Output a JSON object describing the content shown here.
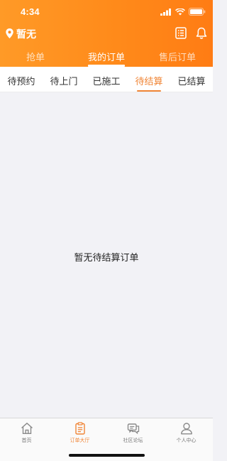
{
  "status_bar": {
    "time": "4:34"
  },
  "header": {
    "location": "暂无",
    "location_icon": "location-pin-icon",
    "list_icon": "list-document-icon",
    "bell_icon": "bell-icon",
    "background_color": "#ff8a1a"
  },
  "top_tabs": [
    {
      "label": "抢单",
      "active": false
    },
    {
      "label": "我的订单",
      "active": true
    },
    {
      "label": "售后订单",
      "active": false
    }
  ],
  "sub_tabs": [
    {
      "label": "待预约",
      "active": false
    },
    {
      "label": "待上门",
      "active": false
    },
    {
      "label": "已施工",
      "active": false
    },
    {
      "label": "待结算",
      "active": true
    },
    {
      "label": "已结算",
      "active": false
    }
  ],
  "main": {
    "empty_message": "暂无待结算订单"
  },
  "tabbar": [
    {
      "label": "首页",
      "icon": "home-icon",
      "active": false
    },
    {
      "label": "订单大厅",
      "icon": "clipboard-icon",
      "active": true
    },
    {
      "label": "社区论坛",
      "icon": "chat-bubbles-icon",
      "active": false
    },
    {
      "label": "个人中心",
      "icon": "person-icon",
      "active": false
    }
  ],
  "colors": {
    "accent": "#f08536",
    "header": "#ff8a1a"
  }
}
